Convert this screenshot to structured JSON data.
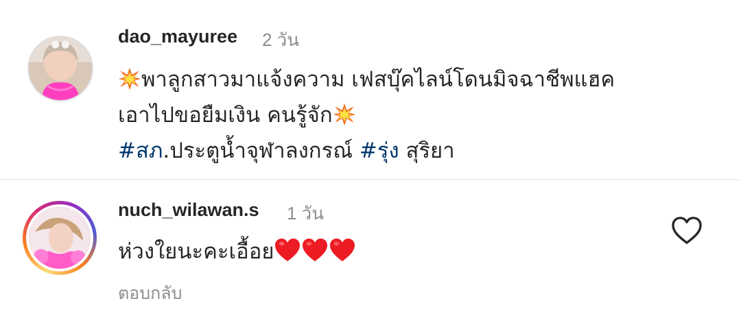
{
  "comments": [
    {
      "username": "dao_mayuree",
      "time": "2 วัน",
      "avatar_icon": "profile-photo",
      "lines": {
        "line1_text": "พาลูกสาวมาแจ้งความ เฟสบุ๊คไลน์โดนมิจฉาชีพแฮค",
        "line2_text": "เอาไปขอยืมเงิน คนรู้จัก",
        "line3_hashtag1": "#สภ",
        "line3_text1": ".ประตูน้ำจุฬาลงกรณ์ ",
        "line3_hashtag2": "#รุ่ง",
        "line3_text2": " สุริยา"
      },
      "emoji_icon": "collision-icon"
    },
    {
      "username": "nuch_wilawan.s",
      "time": "1 วัน",
      "avatar_icon": "profile-photo-with-story-ring",
      "text": "ห่วงใยนะคะเอื้อย",
      "emoji_icon": "red-heart-icon",
      "emoji_count": 3,
      "reply_label": "ตอบกลับ",
      "like_icon": "heart-outline-icon"
    }
  ],
  "colors": {
    "text": "#262626",
    "secondary": "#8e8e8e",
    "hashtag": "#00376b",
    "divider": "#efefef",
    "heart": "#ed1c24"
  }
}
